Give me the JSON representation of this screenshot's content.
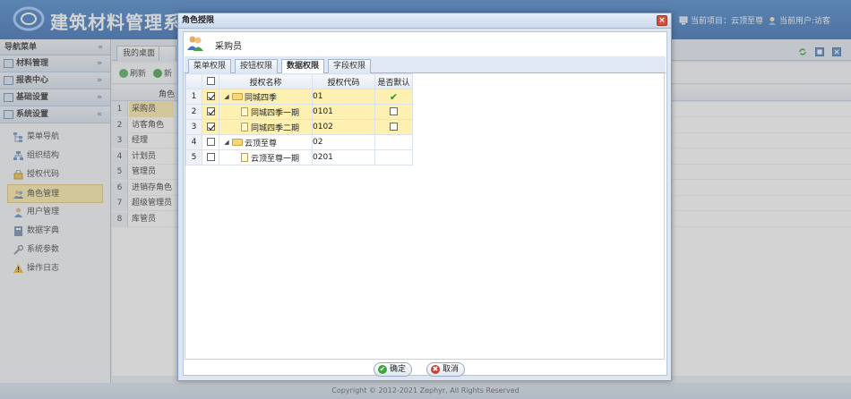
{
  "app": {
    "title": "建筑材料管理系"
  },
  "header": {
    "project_label": "当前项目：云顶至尊",
    "user_label": "当前用户:访客"
  },
  "sidebar": {
    "title": "导航菜单",
    "collapse_glyph": "«",
    "groups": [
      {
        "label": "材料管理",
        "chevron": "»"
      },
      {
        "label": "报表中心",
        "chevron": "»"
      },
      {
        "label": "基础设置",
        "chevron": "»"
      },
      {
        "label": "系统设置",
        "chevron": "«"
      }
    ],
    "items": [
      {
        "label": "菜单导航",
        "icon": "menu-tree-icon"
      },
      {
        "label": "组织结构",
        "icon": "org-chart-icon"
      },
      {
        "label": "授权代码",
        "icon": "key-icon"
      },
      {
        "label": "角色管理",
        "icon": "role-icon"
      },
      {
        "label": "用户管理",
        "icon": "user-icon"
      },
      {
        "label": "数据字典",
        "icon": "book-icon"
      },
      {
        "label": "系统参数",
        "icon": "wrench-icon"
      },
      {
        "label": "操作日志",
        "icon": "warning-icon"
      }
    ]
  },
  "main": {
    "tabs": [
      "我的桌面"
    ],
    "toolbar": {
      "refresh": "刷新",
      "add": "新"
    },
    "column_header": "角色",
    "rows": [
      {
        "n": "1",
        "name": "采购员"
      },
      {
        "n": "2",
        "name": "访客角色"
      },
      {
        "n": "3",
        "name": "经理"
      },
      {
        "n": "4",
        "name": "计划员"
      },
      {
        "n": "5",
        "name": "管理员"
      },
      {
        "n": "6",
        "name": "进销存角色"
      },
      {
        "n": "7",
        "name": "超级管理员"
      },
      {
        "n": "8",
        "name": "库管员"
      }
    ]
  },
  "footer": {
    "copyright": "Copyright © 2012-2021 Zephyr, All Rights Reserved"
  },
  "dialog": {
    "title": "角色授限",
    "role_name": "采购员",
    "close_glyph": "×",
    "tabs": [
      {
        "label": "菜单权限",
        "active": false
      },
      {
        "label": "按钮权限",
        "active": false
      },
      {
        "label": "数据权限",
        "active": true
      },
      {
        "label": "字段权限",
        "active": false
      }
    ],
    "columns": {
      "name": "授权名称",
      "code": "授权代码",
      "default": "是否默认"
    },
    "rows": [
      {
        "n": "1",
        "checked": true,
        "level": 0,
        "expander": "◢",
        "type": "folder",
        "name": "同城四季",
        "code": "01",
        "default": "check",
        "selected": true
      },
      {
        "n": "2",
        "checked": true,
        "level": 1,
        "expander": "",
        "type": "doc",
        "name": "同城四季一期",
        "code": "0101",
        "default": "checkbox",
        "selected": true
      },
      {
        "n": "3",
        "checked": true,
        "level": 1,
        "expander": "",
        "type": "doc",
        "name": "同城四季二期",
        "code": "0102",
        "default": "checkbox",
        "selected": true
      },
      {
        "n": "4",
        "checked": false,
        "level": 0,
        "expander": "◢",
        "type": "folder",
        "name": "云顶至尊",
        "code": "02",
        "default": "",
        "selected": false
      },
      {
        "n": "5",
        "checked": false,
        "level": 1,
        "expander": "",
        "type": "doc",
        "name": "云顶至尊一期",
        "code": "0201",
        "default": "",
        "selected": false
      }
    ],
    "buttons": {
      "ok": "确定",
      "cancel": "取消"
    },
    "default_check_glyph": "✔",
    "ok_glyph": "✔",
    "cancel_glyph": "✖"
  },
  "colors": {
    "header_blue": "#2f6db9",
    "highlight": "#fdeaa5",
    "check_green": "#1e9a1e",
    "cancel_red": "#c9402e"
  }
}
